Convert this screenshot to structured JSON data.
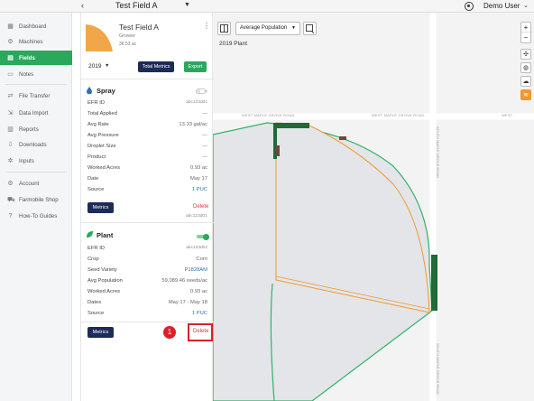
{
  "topbar": {
    "back_icon": "chevron-left-icon",
    "field_title": "Test Field A",
    "user_name": "Demo User"
  },
  "sidebar": {
    "items": [
      {
        "label": "Dashboard",
        "icon": "dashboard-icon"
      },
      {
        "label": "Machines",
        "icon": "machine-icon"
      },
      {
        "label": "Fields",
        "icon": "grid-icon",
        "active": true
      },
      {
        "label": "Notes",
        "icon": "note-icon"
      },
      {
        "label": "File Transfer",
        "icon": "transfer-icon"
      },
      {
        "label": "Data Import",
        "icon": "import-icon"
      },
      {
        "label": "Reports",
        "icon": "report-icon"
      },
      {
        "label": "Downloads",
        "icon": "download-icon"
      },
      {
        "label": "Inputs",
        "icon": "inputs-icon"
      },
      {
        "label": "Account",
        "icon": "account-icon"
      },
      {
        "label": "Farmobile Shop",
        "icon": "cart-icon"
      },
      {
        "label": "How-To Guides",
        "icon": "help-icon"
      }
    ]
  },
  "panel": {
    "field_name": "Test Field A",
    "grower": "Grower",
    "acres": "36.53 ac",
    "year": "2019",
    "total_metrics_label": "Total Metrics",
    "export_label": "Export",
    "spray": {
      "title": "Spray",
      "toggle_text": "on",
      "rows": [
        {
          "k": "EFR ID",
          "v": "abc123d01",
          "tiny": true
        },
        {
          "k": "Total Applied",
          "v": "---"
        },
        {
          "k": "Avg Rate",
          "v": "13.33 gal/ac"
        },
        {
          "k": "Avg Pressure",
          "v": "---"
        },
        {
          "k": "Droplet Size",
          "v": "---"
        },
        {
          "k": "Product",
          "v": "---"
        },
        {
          "k": "Worked Acres",
          "v": "0.93 ac"
        },
        {
          "k": "Date",
          "v": "May 17"
        },
        {
          "k": "Source",
          "v": "1 PUC",
          "blue": true
        }
      ],
      "metrics_label": "Metrics",
      "delete_label": "Delete",
      "footer_id": "abc123d01"
    },
    "plant": {
      "title": "Plant",
      "rows": [
        {
          "k": "EFR ID",
          "v": "abc123d02",
          "tiny": true
        },
        {
          "k": "Crop",
          "v": "Corn"
        },
        {
          "k": "Seed Variety",
          "v": "P1828AM",
          "blue": true
        },
        {
          "k": "Avg Population",
          "v": "59,089.46 seeds/ac"
        },
        {
          "k": "Worked Acres",
          "v": "0.93 ac"
        },
        {
          "k": "Dates",
          "v": "May 17 - May 18"
        },
        {
          "k": "Source",
          "v": "1 PUC",
          "blue": true
        }
      ],
      "metrics_label": "Metrics",
      "delete_label": "Delete"
    },
    "step_number": "1"
  },
  "map": {
    "layer_select": "Average Population",
    "title": "2019 Plant",
    "road_h": "WEST MAPLE GROVE ROAD",
    "road_v": "SOUTH MAPLE GROVE ROAD",
    "zoom_in": "+",
    "zoom_out": "−",
    "colors": {
      "field_fill": "#e3e5e8",
      "boundary": "#2fb36a",
      "plant_line": "#f2982f",
      "coverage": "#1f6a35",
      "accent_green": "#2aa85c",
      "navy": "#1d2b59",
      "delete_red": "#d23c3c"
    }
  }
}
